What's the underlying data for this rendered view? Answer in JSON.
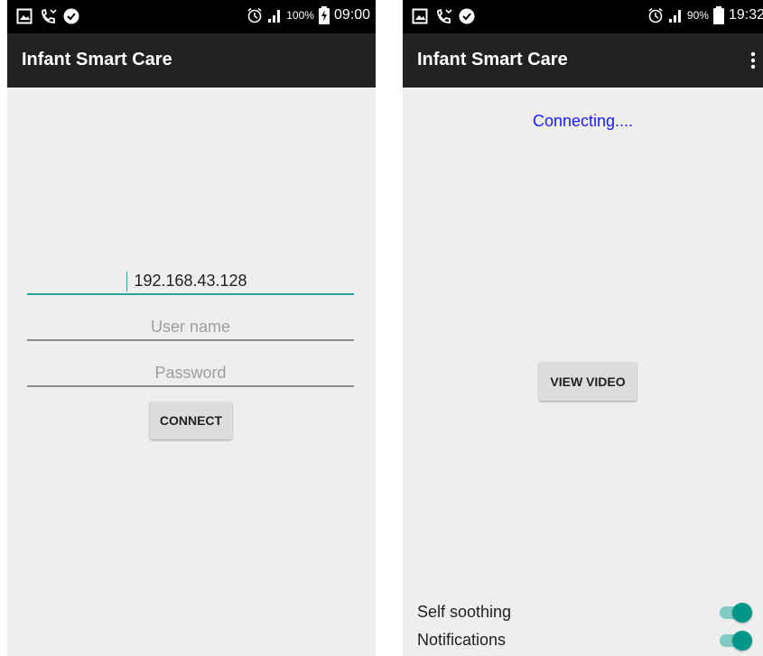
{
  "colors": {
    "accent": "#009688",
    "accent_light": "#80cbc4",
    "status_link": "#1a1aff",
    "app_bar": "#212121",
    "background": "#eeeeee"
  },
  "left_screen": {
    "status_bar": {
      "icons": [
        "gallery-icon",
        "phone-missed-icon",
        "check-circle-icon",
        "alarm-icon",
        "signal-icon",
        "battery-charging-icon"
      ],
      "battery_percent": "100%",
      "time": "09:00"
    },
    "app_title": "Infant Smart Care",
    "ip_field": {
      "value": "192.168.43.128"
    },
    "username_field": {
      "placeholder": "User name"
    },
    "password_field": {
      "placeholder": "Password"
    },
    "connect_label": "CONNECT"
  },
  "right_screen": {
    "status_bar": {
      "icons": [
        "gallery-icon",
        "phone-missed-icon",
        "check-circle-icon",
        "alarm-icon",
        "signal-icon",
        "battery-icon"
      ],
      "battery_percent": "90%",
      "time": "19:32"
    },
    "app_title": "Infant Smart Care",
    "menu_icon": "overflow-menu-icon",
    "status_text": "Connecting....",
    "view_video_label": "VIEW VIDEO",
    "toggles": [
      {
        "label": "Self soothing",
        "on": true
      },
      {
        "label": "Notifications",
        "on": true
      }
    ]
  }
}
